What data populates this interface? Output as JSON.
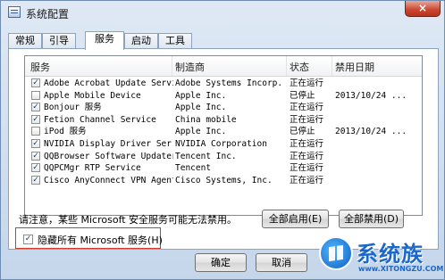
{
  "window": {
    "title": "系统配置",
    "close_label": "×"
  },
  "tabs": [
    "常规",
    "引导",
    "服务",
    "启动",
    "工具"
  ],
  "active_tab": "服务",
  "table": {
    "columns": [
      "服务",
      "制造商",
      "状态",
      "禁用日期"
    ],
    "rows": [
      {
        "checked": true,
        "service": "Adobe Acrobat Update Service",
        "maker": "Adobe Systems Incorp...",
        "status": "正在运行",
        "disabled_date": ""
      },
      {
        "checked": false,
        "service": "Apple Mobile Device",
        "maker": "Apple Inc.",
        "status": "已停止",
        "disabled_date": "2013/10/24 ..."
      },
      {
        "checked": true,
        "service": "Bonjour 服务",
        "maker": "Apple Inc.",
        "status": "正在运行",
        "disabled_date": ""
      },
      {
        "checked": true,
        "service": "Fetion Channel Service",
        "maker": "China mobile",
        "status": "正在运行",
        "disabled_date": ""
      },
      {
        "checked": false,
        "service": "iPod 服务",
        "maker": "Apple Inc.",
        "status": "已停止",
        "disabled_date": "2013/10/24 ..."
      },
      {
        "checked": true,
        "service": "NVIDIA Display Driver Ser...",
        "maker": "NVIDIA Corporation",
        "status": "正在运行",
        "disabled_date": ""
      },
      {
        "checked": true,
        "service": "QQBrowser Software Updater",
        "maker": "Tencent Inc.",
        "status": "正在运行",
        "disabled_date": ""
      },
      {
        "checked": true,
        "service": "QQPCMgr RTP Service",
        "maker": "Tencent",
        "status": "正在运行",
        "disabled_date": ""
      },
      {
        "checked": true,
        "service": "Cisco AnyConnect VPN Agent",
        "maker": "Cisco Systems, Inc.",
        "status": "正在运行",
        "disabled_date": ""
      }
    ]
  },
  "note": "请注意，某些 Microsoft 安全服务可能无法禁用。",
  "buttons": {
    "enable_all": "全部启用(E)",
    "disable_all": "全部禁用(D)",
    "ok": "确定",
    "cancel": "取消"
  },
  "hide_ms": {
    "checked": true,
    "label": "隐藏所有 Microsoft 服务(H)"
  },
  "watermark": {
    "text": "系统族",
    "url": "www.XITONGZU.COM"
  }
}
